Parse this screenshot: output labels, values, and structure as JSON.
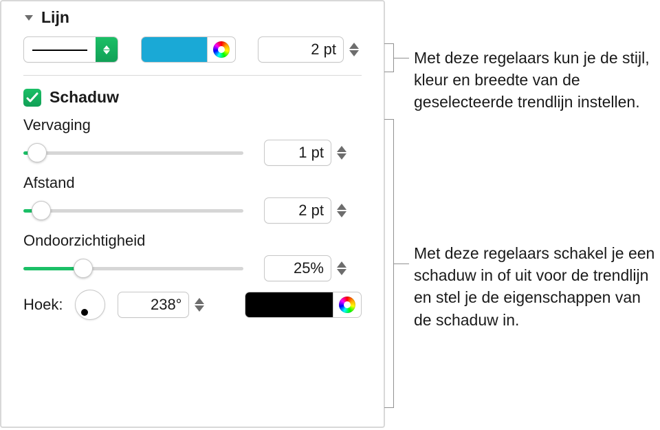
{
  "section_line_title": "Lijn",
  "line": {
    "width_value": "2 pt",
    "swatch_color": "#1aa9d6"
  },
  "shadow": {
    "title": "Schaduw",
    "checked": true,
    "blur_label": "Vervaging",
    "blur_value": "1 pt",
    "offset_label": "Afstand",
    "offset_value": "2 pt",
    "opacity_label": "Ondoorzichtigheid",
    "opacity_value": "25%",
    "angle_label": "Hoek:",
    "angle_value": "238°",
    "swatch_color": "#000000"
  },
  "callout_line": "Met deze regelaars kun je de stijl, kleur en breedte van de geselecteerde trendlijn instellen.",
  "callout_shadow": "Met deze regelaars schakel je een schaduw in of uit voor de trendlijn en stel je de eigenschappen van de schaduw in."
}
